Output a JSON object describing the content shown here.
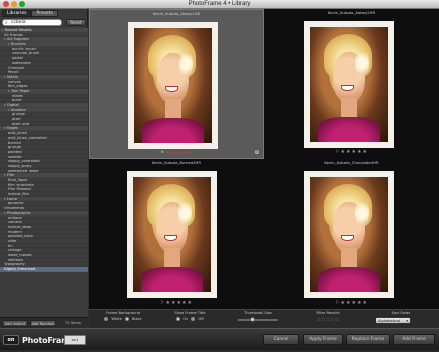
{
  "window": {
    "title": "PhotoFrame 4 • Library"
  },
  "sidebar": {
    "tabs": [
      "Libraries",
      "Presets"
    ],
    "search": {
      "value": "ccbela"
    },
    "reset_label": "Reset",
    "tree": [
      {
        "label": "Recent Results",
        "level": 0,
        "header": true
      },
      {
        "label": "All Frames",
        "level": 1
      },
      {
        "label": "Art Supplies",
        "level": 1,
        "header": true
      },
      {
        "label": "Brushes",
        "level": 2,
        "header": true
      },
      {
        "label": "acrylic_brush",
        "level": 3
      },
      {
        "label": "charcoal_brush",
        "level": 3
      },
      {
        "label": "pastel",
        "level": 3
      },
      {
        "label": "watercolor",
        "level": 3
      },
      {
        "label": "Charcoal",
        "level": 2
      },
      {
        "label": "Pencil",
        "level": 2
      },
      {
        "label": "Media",
        "level": 1,
        "header": true
      },
      {
        "label": "canvas",
        "level": 2
      },
      {
        "label": "film_edges",
        "level": 2
      },
      {
        "label": "Torn Paper",
        "level": 2,
        "header": true
      },
      {
        "label": "edges",
        "level": 3
      },
      {
        "label": "burnt",
        "level": 3
      },
      {
        "label": "Digital",
        "level": 1,
        "header": true
      },
      {
        "label": "Imaging",
        "level": 2,
        "header": true
      },
      {
        "label": "grunge",
        "level": 3
      },
      {
        "label": "pixel",
        "level": 3
      },
      {
        "label": "pixel_grid",
        "level": 3
      },
      {
        "label": "Edges",
        "level": 1,
        "header": true
      },
      {
        "label": "acid_blush",
        "level": 2
      },
      {
        "label": "acid_blush_controlled",
        "level": 2
      },
      {
        "label": "burned",
        "level": 2
      },
      {
        "label": "grunge",
        "level": 2
      },
      {
        "label": "painted",
        "level": 2
      },
      {
        "label": "splatter",
        "level": 2
      },
      {
        "label": "sloppy_controlled",
        "level": 2
      },
      {
        "label": "sloppy_spray",
        "level": 2
      },
      {
        "label": "weathered_sepia",
        "level": 2
      },
      {
        "label": "Film",
        "level": 1,
        "header": true
      },
      {
        "label": "fluid_liquor",
        "level": 2
      },
      {
        "label": "film_sprockets",
        "level": 2
      },
      {
        "label": "Film Polaroid",
        "level": 2
      },
      {
        "label": "instant_film",
        "level": 2
      },
      {
        "label": "Lomo",
        "level": 1,
        "header": true
      },
      {
        "label": "gouache",
        "level": 2
      },
      {
        "label": "Ornaments",
        "level": 1
      },
      {
        "label": "Photographic",
        "level": 1,
        "header": true
      },
      {
        "label": "antique",
        "level": 2
      },
      {
        "label": "camera",
        "level": 2
      },
      {
        "label": "instant_deep",
        "level": 2
      },
      {
        "label": "modern",
        "level": 2
      },
      {
        "label": "polaroid_back",
        "level": 2
      },
      {
        "label": "slide",
        "level": 2
      },
      {
        "label": "tin",
        "level": 2
      },
      {
        "label": "vintage",
        "level": 2
      },
      {
        "label": "wave_mosaic",
        "level": 2
      },
      {
        "label": "whitepix",
        "level": 2
      },
      {
        "label": "Typography",
        "level": 1
      },
      {
        "label": "Digital_Enhanced",
        "level": 1,
        "selected": true
      }
    ],
    "footer": {
      "add_instant": "Add Instant",
      "add_random": "Add Random",
      "count": "72 Items"
    }
  },
  "grid": {
    "cells": [
      {
        "name": "Kevin_Kubota_Abbey1HR",
        "stars": 5,
        "rating": 0,
        "selected": true
      },
      {
        "name": "Kevin_Kubota_Abbey2HR",
        "stars": 5,
        "rating": 0,
        "selected": false
      },
      {
        "name": "Kevin_Kubota_Burned4HR",
        "stars": 5,
        "rating": 0,
        "selected": false
      },
      {
        "name": "Kevin_Kubota_Chocolate4HR",
        "stars": 5,
        "rating": 0,
        "selected": false
      }
    ],
    "colors": {
      "red": "#d33333",
      "green": "#44cc44"
    }
  },
  "controls": {
    "frame_background": {
      "label": "Frame Background",
      "options": [
        "White",
        "Black"
      ],
      "selected": "White"
    },
    "show_frame_title": {
      "label": "Show Frame Title",
      "options": [
        "On",
        "Off"
      ],
      "selected": "Off"
    },
    "thumbnail_size": {
      "label": "Thumbnail Size",
      "value": 0.35
    },
    "filter_results": {
      "label": "Filter Results"
    },
    "sort_order": {
      "label": "Sort Order",
      "value": "Alphabetical"
    }
  },
  "bottombar": {
    "logo_mark": "on",
    "logo_word": "PhotoFrame",
    "badge": "on1\nsoftware",
    "buttons": {
      "cancel": "Cancel",
      "apply": "Apply Frame",
      "replace": "Replace Frame",
      "add": "Add Frame"
    }
  }
}
